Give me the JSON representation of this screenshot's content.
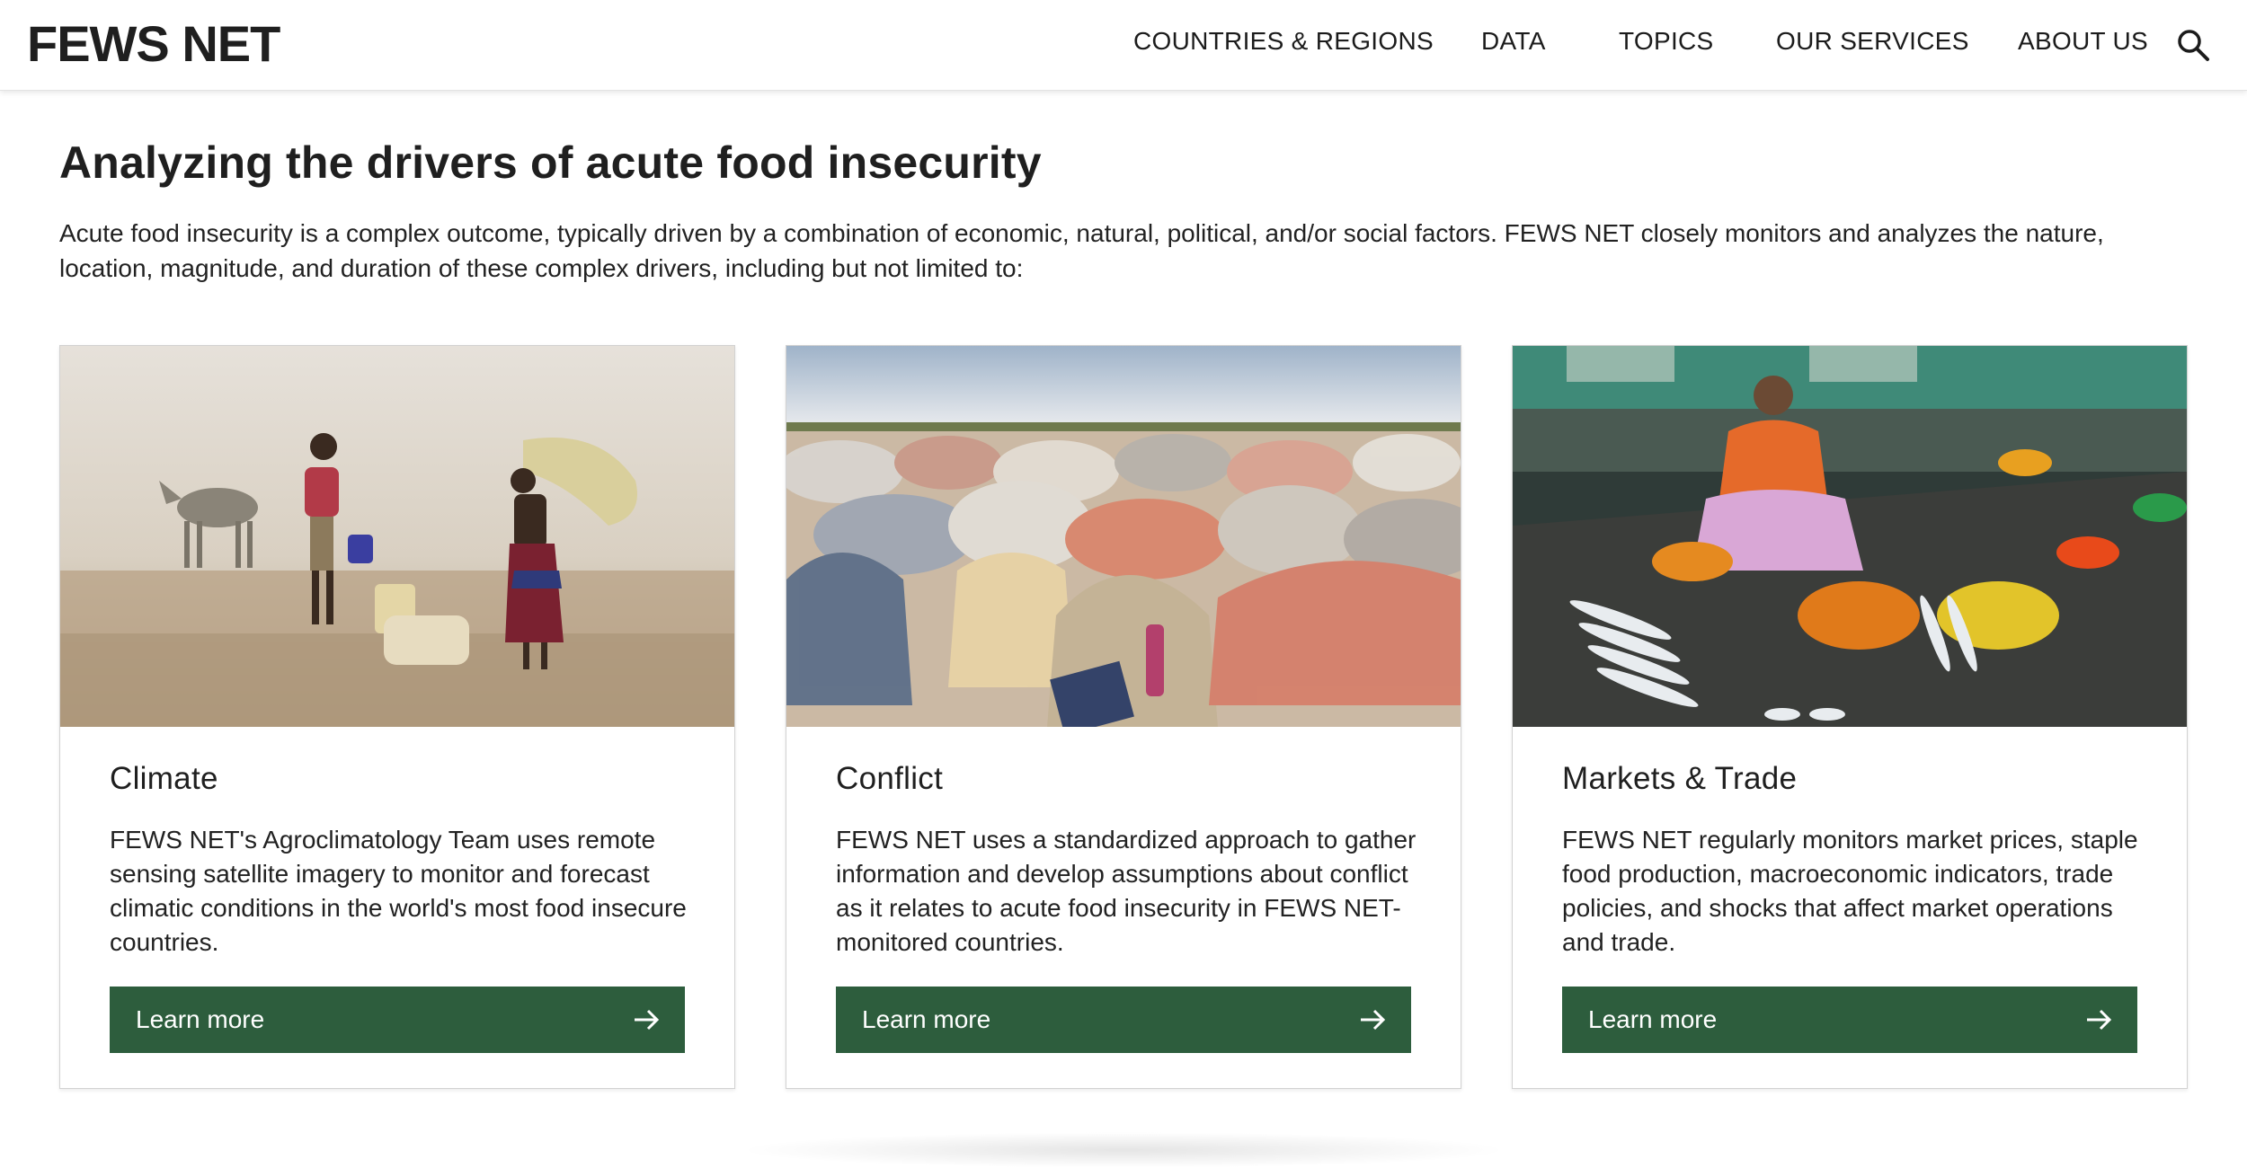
{
  "header": {
    "logo": "FEWS NET",
    "nav": [
      {
        "label": "COUNTRIES & REGIONS"
      },
      {
        "label": "DATA"
      },
      {
        "label": "TOPICS"
      },
      {
        "label": "OUR SERVICES"
      },
      {
        "label": "ABOUT US"
      }
    ],
    "search_icon": "search-icon"
  },
  "main": {
    "title": "Analyzing the drivers of acute food insecurity",
    "intro": "Acute food insecurity is a complex outcome, typically driven by a combination of economic, natural, political, and/or social factors. FEWS NET closely monitors and analyzes the nature, location, magnitude, and duration of these complex drivers, including but not limited to:",
    "cards": [
      {
        "title": "Climate",
        "text": "FEWS NET's Agroclimatology Team uses remote sensing satellite imagery to monitor and forecast climatic conditions in the world's most food insecure countries.",
        "button": "Learn more",
        "image": "people-fetching-water-in-dusty-landscape-photo"
      },
      {
        "title": "Conflict",
        "text": "FEWS NET uses a standardized approach to gather information and develop assumptions about conflict as it relates to acute food insecurity in FEWS NET-monitored countries.",
        "button": "Learn more",
        "image": "displacement-camp-tents-photo"
      },
      {
        "title": "Markets & Trade",
        "text": "FEWS NET regularly monitors market prices, staple food production, macroeconomic indicators, trade policies, and shocks that affect market operations and trade.",
        "button": "Learn more",
        "image": "woman-selling-fish-at-market-photo"
      }
    ]
  },
  "colors": {
    "button_green": "#2d5d3d",
    "text_dark": "#1f1f1f"
  }
}
